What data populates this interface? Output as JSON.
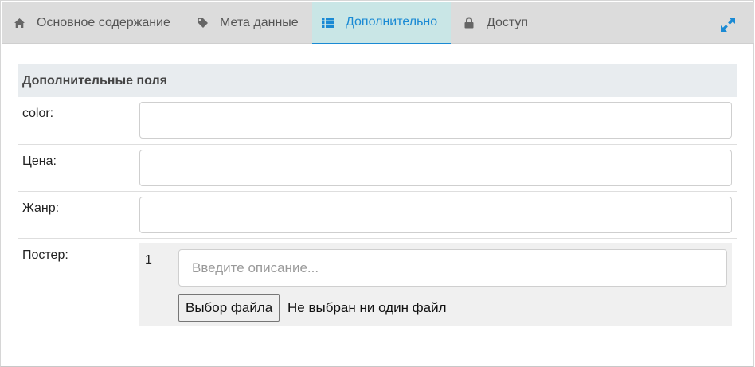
{
  "tabs": [
    {
      "label": "Основное содержание",
      "icon": "home-icon"
    },
    {
      "label": "Мета данные",
      "icon": "tag-icon"
    },
    {
      "label": "Дополнительно",
      "icon": "list-icon",
      "active": true
    },
    {
      "label": "Доступ",
      "icon": "lock-icon"
    }
  ],
  "colors": {
    "active_tab_bg": "#c9e6e6",
    "active_tab_text": "#1a8ad4",
    "expand_icon": "#1a8ad4"
  },
  "section": {
    "title": "Дополнительные поля"
  },
  "fields": [
    {
      "label": "color:",
      "value": ""
    },
    {
      "label": "Цена:",
      "value": ""
    },
    {
      "label": "Жанр:",
      "value": ""
    }
  ],
  "poster": {
    "label": "Постер:",
    "index": "1",
    "description_placeholder": "Введите описание...",
    "file_button": "Выбор файла",
    "file_status": "Не выбран ни один файл"
  }
}
